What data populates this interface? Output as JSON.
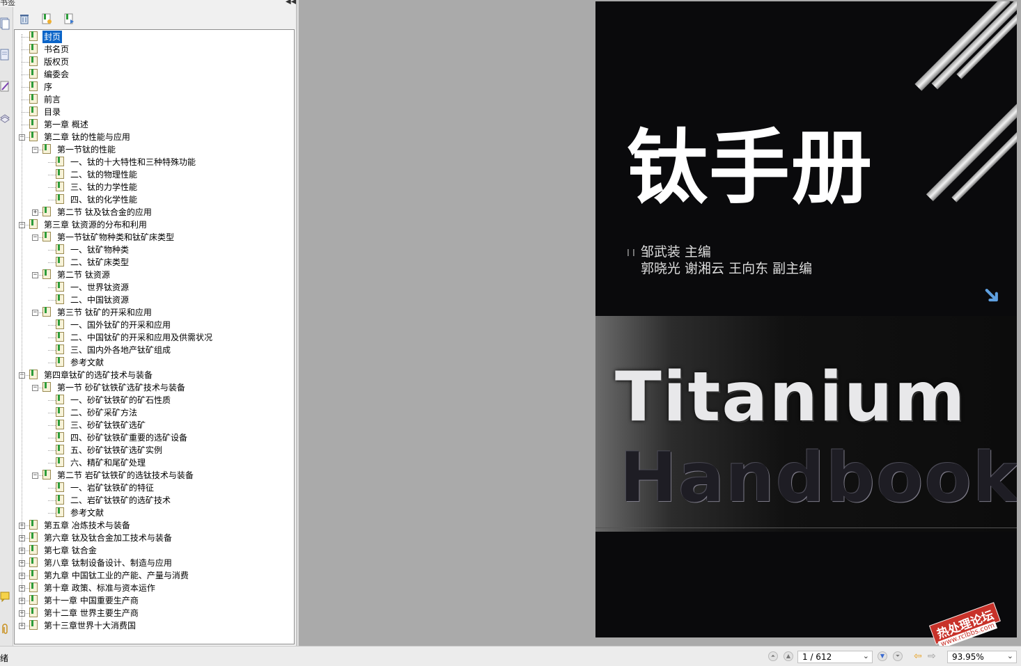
{
  "panel": {
    "title": "书签",
    "collapse_icon": "double-chevron-left-icon"
  },
  "toolbar": {
    "buttons": [
      "delete-bookmark-icon",
      "new-bookmark-icon",
      "bookmark-options-icon"
    ]
  },
  "bookmarks": [
    {
      "label": "封页",
      "level": 0,
      "expander": null,
      "selected": true
    },
    {
      "label": "书名页",
      "level": 0,
      "expander": null
    },
    {
      "label": "版权页",
      "level": 0,
      "expander": null
    },
    {
      "label": "编委会",
      "level": 0,
      "expander": null
    },
    {
      "label": "序",
      "level": 0,
      "expander": null
    },
    {
      "label": "前言",
      "level": 0,
      "expander": null
    },
    {
      "label": "目录",
      "level": 0,
      "expander": null
    },
    {
      "label": "第一章 概述",
      "level": 0,
      "expander": null
    },
    {
      "label": "第二章 钛的性能与应用",
      "level": 0,
      "expander": "minus"
    },
    {
      "label": "第一节钛的性能",
      "level": 1,
      "expander": "minus"
    },
    {
      "label": "一、钛的十大特性和三种特殊功能",
      "level": 2,
      "expander": null
    },
    {
      "label": "二、钛的物理性能",
      "level": 2,
      "expander": null
    },
    {
      "label": "三、钛的力学性能",
      "level": 2,
      "expander": null
    },
    {
      "label": "四、钛的化学性能",
      "level": 2,
      "expander": null
    },
    {
      "label": "第二节 钛及钛合金的应用",
      "level": 1,
      "expander": "plus"
    },
    {
      "label": "第三章 钛资源的分布和利用",
      "level": 0,
      "expander": "minus"
    },
    {
      "label": "第一节钛矿物种类和钛矿床类型",
      "level": 1,
      "expander": "minus"
    },
    {
      "label": "一、钛矿物种类",
      "level": 2,
      "expander": null
    },
    {
      "label": "二、钛矿床类型",
      "level": 2,
      "expander": null
    },
    {
      "label": "第二节 钛资源",
      "level": 1,
      "expander": "minus"
    },
    {
      "label": "一、世界钛资源",
      "level": 2,
      "expander": null
    },
    {
      "label": "二、中国钛资源",
      "level": 2,
      "expander": null
    },
    {
      "label": "第三节 钛矿的开采和应用",
      "level": 1,
      "expander": "minus"
    },
    {
      "label": "一、国外钛矿的开采和应用",
      "level": 2,
      "expander": null
    },
    {
      "label": "二、中国钛矿的开采和应用及供需状况",
      "level": 2,
      "expander": null
    },
    {
      "label": "三、国内外各地产钛矿组成",
      "level": 2,
      "expander": null
    },
    {
      "label": "参考文献",
      "level": 2,
      "expander": null
    },
    {
      "label": "第四章钛矿的选矿技术与装备",
      "level": 0,
      "expander": "minus"
    },
    {
      "label": "第一节 砂矿钛铁矿选矿技术与装备",
      "level": 1,
      "expander": "minus"
    },
    {
      "label": "一、砂矿钛铁矿的矿石性质",
      "level": 2,
      "expander": null
    },
    {
      "label": "二、砂矿采矿方法",
      "level": 2,
      "expander": null
    },
    {
      "label": "三、砂矿钛铁矿选矿",
      "level": 2,
      "expander": null
    },
    {
      "label": "四、砂矿钛铁矿重要的选矿设备",
      "level": 2,
      "expander": null
    },
    {
      "label": "五、砂矿钛铁矿选矿实例",
      "level": 2,
      "expander": null
    },
    {
      "label": "六、精矿和尾矿处理",
      "level": 2,
      "expander": null
    },
    {
      "label": "第二节 岩矿钛铁矿的选钛技术与装备",
      "level": 1,
      "expander": "minus"
    },
    {
      "label": "一、岩矿钛铁矿的特征",
      "level": 2,
      "expander": null
    },
    {
      "label": "二、岩矿钛铁矿的选矿技术",
      "level": 2,
      "expander": null
    },
    {
      "label": "参考文献",
      "level": 2,
      "expander": null
    },
    {
      "label": "第五章 冶炼技术与装备",
      "level": 0,
      "expander": "plus"
    },
    {
      "label": "第六章 钛及钛合金加工技术与装备",
      "level": 0,
      "expander": "plus"
    },
    {
      "label": "第七章 钛合金",
      "level": 0,
      "expander": "plus"
    },
    {
      "label": "第八章 钛制设备设计、制造与应用",
      "level": 0,
      "expander": "plus"
    },
    {
      "label": "第九章 中国钛工业的产能、产量与消费",
      "level": 0,
      "expander": "plus"
    },
    {
      "label": "第十章 政策、标准与资本运作",
      "level": 0,
      "expander": "plus"
    },
    {
      "label": "第十一章 中国重要生产商",
      "level": 0,
      "expander": "plus"
    },
    {
      "label": "第十二章 世界主要生产商",
      "level": 0,
      "expander": "plus"
    },
    {
      "label": "第十三章世界十大消费国",
      "level": 0,
      "expander": "plus"
    }
  ],
  "cover": {
    "title": "钛手册",
    "editor_mark": "I I",
    "editor_line1": "邹武装    主编",
    "editor_line2": "郭晓光    谢湘云    王向东       副主编",
    "en_line1": "Titanium",
    "en_line2": "Handbook",
    "arrow_icon": "arrow-down-right-icon"
  },
  "watermark": {
    "main": "热处理论坛",
    "url": "www.rclbbs.com"
  },
  "status": {
    "text": "绪",
    "page_display": "1 / 612",
    "zoom": "93.95%"
  },
  "colors": {
    "selection": "#0a64c8",
    "doc_background": "#aaaaaa",
    "cover_background": "#0a0a0c",
    "watermark_red": "#c8322a"
  }
}
